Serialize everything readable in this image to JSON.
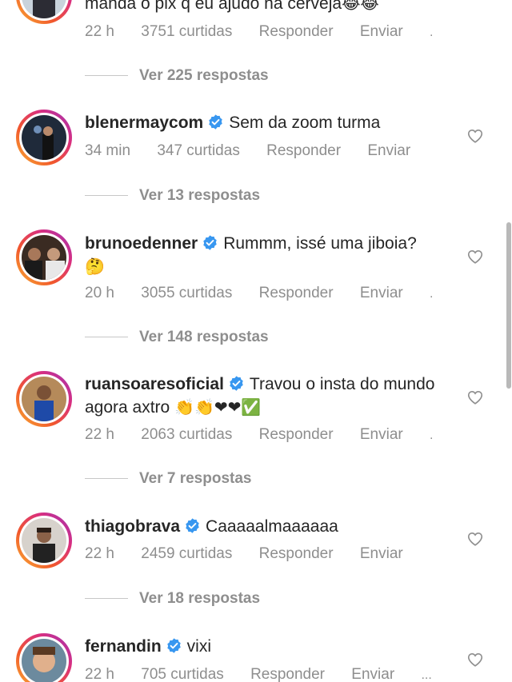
{
  "comments": [
    {
      "username": "",
      "text": "manda o pix q eu ajudo na cerveja",
      "emoji": "😂😂",
      "time": "22 h",
      "likes": "3751 curtidas",
      "reply_label": "Responder",
      "send_label": "Enviar",
      "replies": "Ver 225 respostas"
    },
    {
      "username": "blenermaycom",
      "text": "Sem da zoom turma",
      "emoji": "",
      "time": "34 min",
      "likes": "347 curtidas",
      "reply_label": "Responder",
      "send_label": "Enviar",
      "replies": "Ver 13 respostas"
    },
    {
      "username": "brunoedenner",
      "text": "Rummm, issé uma jiboia?",
      "emoji": "🤔",
      "time": "20 h",
      "likes": "3055 curtidas",
      "reply_label": "Responder",
      "send_label": "Enviar",
      "replies": "Ver 148 respostas"
    },
    {
      "username": "ruansoaresoficial",
      "text": "Travou o insta do mundo agora axtro",
      "emoji": "👏👏❤❤✅",
      "time": "22 h",
      "likes": "2063 curtidas",
      "reply_label": "Responder",
      "send_label": "Enviar",
      "replies": "Ver 7 respostas"
    },
    {
      "username": "thiagobrava",
      "text": "Caaaaalmaaaaaa",
      "emoji": "",
      "time": "22 h",
      "likes": "2459 curtidas",
      "reply_label": "Responder",
      "send_label": "Enviar",
      "replies": "Ver 18 respostas"
    },
    {
      "username": "fernandin",
      "text": "vixi",
      "emoji": "",
      "time": "22 h",
      "likes": "705 curtidas",
      "reply_label": "Responder",
      "send_label": "Enviar",
      "replies": ""
    }
  ],
  "colors": {
    "verified": "#3897f0",
    "meta": "#8e8e8e",
    "text": "#262626"
  },
  "icons": {
    "verified": "verified-badge-icon",
    "like": "heart-outline-icon",
    "more": "more-dots-icon"
  }
}
